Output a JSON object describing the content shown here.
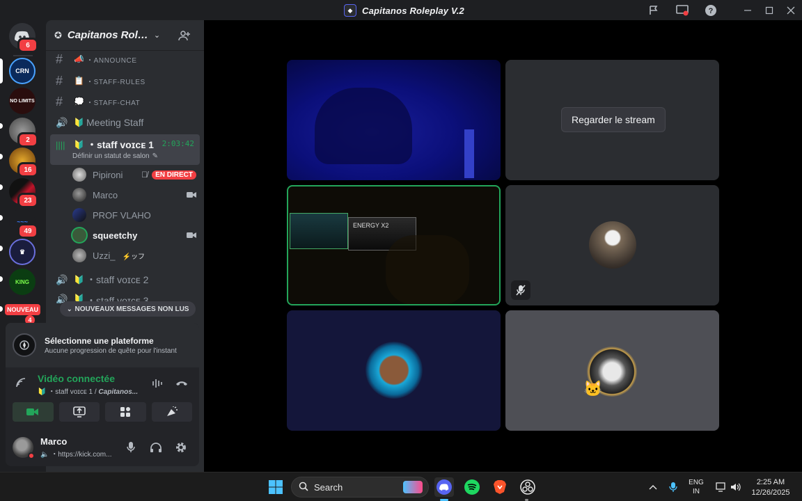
{
  "window": {
    "title": "Capitanos Roleplay V.2"
  },
  "rail": {
    "servers": [
      {
        "name": "home",
        "badge": "6"
      },
      {
        "name": "crn",
        "badge": ""
      },
      {
        "name": "no-limits",
        "badge": ""
      },
      {
        "name": "server-3",
        "badge": "2"
      },
      {
        "name": "server-4",
        "badge": "16"
      },
      {
        "name": "server-5",
        "badge": "23"
      },
      {
        "name": "server-6",
        "badge": "49"
      },
      {
        "name": "server-7",
        "badge": ""
      },
      {
        "name": "king-tv",
        "badge": ""
      }
    ],
    "new_label": "NOUVEAU",
    "new_badge": "4"
  },
  "sidebar": {
    "server_name": "Capitanos Rol…",
    "channels": [
      {
        "name": "・ANNOUNCE",
        "emoji": "📣"
      },
      {
        "name": "・STAFF-RULES",
        "emoji": "📋"
      },
      {
        "name": "・STAFF-CHAT",
        "emoji": "💭"
      }
    ],
    "meeting": "Meeting Staff",
    "active": {
      "name": "・staff ᴠᴏɪᴄᴇ 1",
      "timer": "2:03:42",
      "status": "Définir un statut de salon"
    },
    "members": [
      {
        "name": "Pipironi",
        "live": "EN DIRECT",
        "color": "#949ba4"
      },
      {
        "name": "Marco",
        "live": "",
        "color": "#949ba4"
      },
      {
        "name": "PROF VLAHO",
        "live": "",
        "color": "#949ba4"
      },
      {
        "name": "squeetchy",
        "live": "",
        "color": "#f2f3f5"
      },
      {
        "name": "Uzzi_",
        "tag": "⚡ッフ",
        "live": "",
        "color": "#949ba4"
      }
    ],
    "voice2": "・staff ᴠᴏɪᴄᴇ 2",
    "voice3": "・staff ᴠᴏɪᴄᴇ 3",
    "new_messages": "NOUVEAUX MESSAGES NON LUS"
  },
  "quest": {
    "title": "Sélectionne une plateforme",
    "subtitle": "Aucune progression de quête pour l'instant"
  },
  "voice_status": {
    "title": "Vidéo connectée",
    "channel": "・staff ᴠᴏɪᴄᴇ 1 / ",
    "server": "Capitanos..."
  },
  "user": {
    "name": "Marco",
    "status": "・https://kick.com..."
  },
  "stage": {
    "watch_stream": "Regarder le stream"
  },
  "taskbar": {
    "search": "Search",
    "lang_top": "ENG",
    "lang_bottom": "IN",
    "time": "2:25 AM",
    "date": "12/26/2025"
  }
}
